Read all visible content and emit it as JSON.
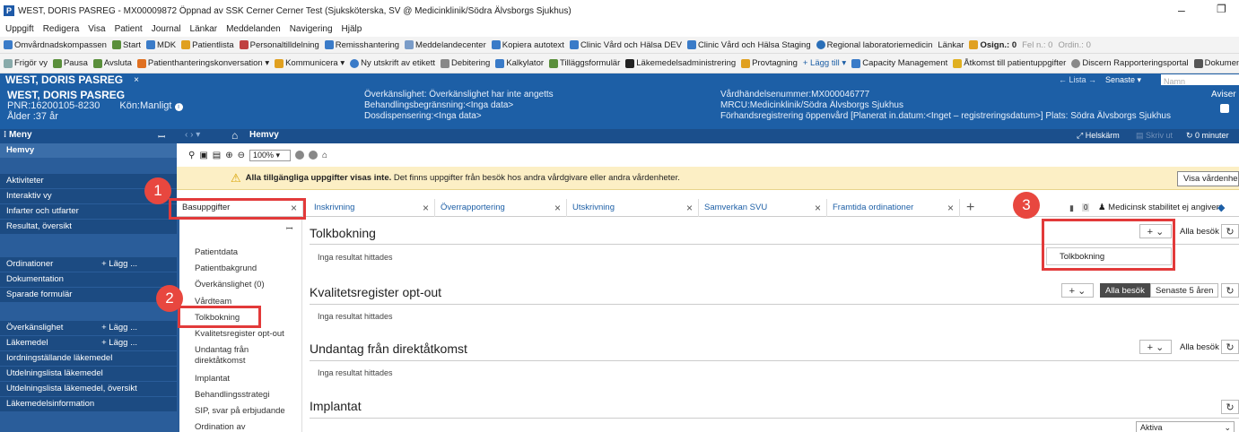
{
  "window": {
    "title": "WEST, DORIS PASREG - MX00009872 Öppnad av SSK Cerner Cerner Test (Sjuksköterska, SV @ Medicinklinik/Södra Älvsborgs Sjukhus)",
    "app_icon": "P",
    "minimize": "–",
    "restore": "❐"
  },
  "menubar": [
    "Uppgift",
    "Redigera",
    "Visa",
    "Patient",
    "Journal",
    "Länkar",
    "Meddelanden",
    "Navigering",
    "Hjälp"
  ],
  "toolbar1": {
    "items": [
      "Omvårdnadskompassen",
      "Start",
      "MDK",
      "Patientlista",
      "Personaltilldelning",
      "Remisshantering",
      "Meddelandecenter",
      "Kopiera autotext",
      "Clinic Vård och Hälsa DEV",
      "Clinic Vård och Hälsa Staging",
      "Regional laboratoriemedicin",
      "Länkar"
    ],
    "osign": "Osign.: 0",
    "feln": "Fel n.: 0",
    "ordin": "Ordin.: 0"
  },
  "toolbar2": {
    "items": [
      "Frigör vy",
      "Pausa",
      "Avsluta",
      "Patienthanteringskonversation ▾",
      "Kommunicera ▾",
      "Ny utskrift av etikett",
      "Debitering",
      "Kalkylator",
      "Tilläggsformulär",
      "Läkemedelsadministrering",
      "Provtagning",
      "+ Lägg till ▾",
      "Capacity Management",
      "Åtkomst till patientuppgifter",
      "Discern Rapporteringsportal",
      "Dokument"
    ]
  },
  "patient_tab": {
    "name": "WEST, DORIS PASREG",
    "close": "×"
  },
  "top_right": {
    "lista": "← Lista →",
    "senaste": "Senaste ▾",
    "search_placeholder": "Namn"
  },
  "banner": {
    "name": "WEST, DORIS PASREG",
    "pnr": "PNR:16200105-8230",
    "kon": "Kön:Manligt",
    "alder": "Ålder :37 år",
    "overkanslighet": "Överkänslighet: Överkänslighet har inte angetts",
    "behandling": "Behandlingsbegränsning:<Inga data>",
    "dos": "Dosdispensering:<Inga data>",
    "vardnr": "Vårdhändelsenummer:MX000046777",
    "mrcu": "MRCU:Medicinklinik/Södra Älvsborgs Sjukhus",
    "forhands": "Förhandsregistrering öppenvård [Planerat in.datum:<Inget – registreringsdatum>] Plats: Södra Älvsborgs Sjukhus",
    "aviser": "Aviser"
  },
  "rowbar": {
    "meny": "Meny",
    "hemvy": "Hemvy",
    "helskarm": "Helskärm",
    "skriv_ut": "Skriv ut",
    "minuter": "0 minuter"
  },
  "sidebar": {
    "items": [
      {
        "label": "Hemvy",
        "style": "lt"
      },
      {
        "label": "Aktiviteter",
        "style": "dark"
      },
      {
        "label": "Interaktiv vy",
        "style": "dark"
      },
      {
        "label": "Infarter och utfarter",
        "style": "dark"
      },
      {
        "label": "Resultat, översikt",
        "style": "dark"
      },
      {
        "label": "Ordinationer",
        "style": "dark",
        "add": "+ Lägg ..."
      },
      {
        "label": "Dokumentation",
        "style": "dark"
      },
      {
        "label": "Sparade formulär",
        "style": "dark"
      },
      {
        "label": "Överkänslighet",
        "style": "dark",
        "add": "+ Lägg ..."
      },
      {
        "label": "Läkemedel",
        "style": "dark",
        "add": "+ Lägg ..."
      },
      {
        "label": "Iordningställande läkemedel",
        "style": "dark"
      },
      {
        "label": "Utdelningslista läkemedel",
        "style": "dark"
      },
      {
        "label": "Utdelningslista läkemedel, översikt",
        "style": "dark"
      },
      {
        "label": "Läkemedelsinformation",
        "style": "dark"
      }
    ]
  },
  "tool_strip": {
    "zoom": "100%"
  },
  "warning": {
    "bold": "Alla tillgängliga uppgifter visas inte.",
    "text": "Det finns uppgifter från besök hos andra vårdgivare eller andra vårdenheter.",
    "button": "Visa vårdenhe"
  },
  "tabs": [
    {
      "label": "Basuppgifter"
    },
    {
      "label": "Inskrivning"
    },
    {
      "label": "Överrapportering"
    },
    {
      "label": "Utskrivning"
    },
    {
      "label": "Samverkan SVU"
    },
    {
      "label": "Framtida ordinationer"
    }
  ],
  "tab_add": "+",
  "tabs_right": {
    "count": "0",
    "stability": "Medicinsk stabilitet ej angiven"
  },
  "leftnav": [
    "Patientdata",
    "Patientbakgrund",
    "Överkänslighet (0)",
    "Vårdteam",
    "Tolkbokning",
    "Kvalitetsregister opt-out",
    "Undantag från direktåtkomst",
    "Implantat",
    "Behandlingsstrategi",
    "SIP, svar på erbjudande",
    "Ordination av"
  ],
  "sections": {
    "tolk": {
      "title": "Tolkbokning",
      "noresult": "Inga resultat hittades",
      "filter": "Alla besök"
    },
    "kval": {
      "title": "Kvalitetsregister opt-out",
      "noresult": "Inga resultat hittades",
      "seg1": "Alla besök",
      "seg2": "Senaste 5 åren"
    },
    "undantag": {
      "title": "Undantag från direktåtkomst",
      "noresult": "Inga resultat hittades",
      "filter": "Alla besök"
    },
    "implantat": {
      "title": "Implantat",
      "select": "Aktiva"
    }
  },
  "dropdown": {
    "item": "Tolkbokning"
  },
  "annotations": [
    "1",
    "2",
    "3"
  ],
  "colors": {
    "banner": "#1d5fa6",
    "sidebar": "#2a5d9a",
    "warning": "#fcefc5",
    "annotation": "#e23a3a"
  }
}
